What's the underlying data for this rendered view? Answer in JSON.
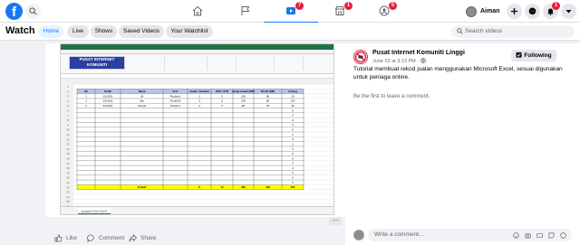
{
  "topbar": {
    "logo": "f",
    "profile_name": "Aiman",
    "nav": [
      {
        "name": "home",
        "badge": ""
      },
      {
        "name": "pages",
        "badge": ""
      },
      {
        "name": "watch",
        "badge": "7"
      },
      {
        "name": "marketplace",
        "badge": "1"
      },
      {
        "name": "groups",
        "badge": "5"
      }
    ],
    "notification_badge": "1"
  },
  "watch": {
    "title": "Watch",
    "tabs": [
      "Home",
      "Live",
      "Shows",
      "Saved Videos",
      "Your Watchlist"
    ],
    "search_placeholder": "Search videos"
  },
  "video": {
    "banner_text": "PUSAT INTERNET KOMUNITI",
    "headers": [
      "Bil",
      "Tarikh",
      "Nama",
      "Item",
      "Jualan / Kuantiti",
      "PKG / STR",
      "Harga Jualan (RM)",
      "Modal (RM)",
      "Untung"
    ],
    "rows": [
      [
        "1",
        "1/1/2021",
        "Ali",
        "Produk A",
        "1",
        "3",
        "100",
        "80",
        "20"
      ],
      [
        "2",
        "2/1/2021",
        "Abu",
        "Produk B",
        "3",
        "5",
        "200",
        "80",
        "120"
      ],
      [
        "3",
        "3/1/2021",
        "Ahmad",
        "Produk A",
        "4",
        "5",
        "80",
        "20",
        "60"
      ]
    ],
    "total_label": "Jumlah",
    "totals": [
      "8",
      "13",
      "380",
      "180",
      "200"
    ],
    "sheet_tab": "Jualan Feb 2021",
    "more_label": "..."
  },
  "actions": {
    "like": "Like",
    "comment": "Comment",
    "share": "Share"
  },
  "post": {
    "page_name": "Pusat Internet Komuniti Linggi",
    "time": "June 22 at 3:13 PM · ",
    "follow_label": "Following",
    "description": "Tutorial membuat rekod jualan menggunakan Microsoft Excel, sesuai digunakan untuk peniaga online.",
    "first_comment": "Be the first to leave a comment.",
    "comment_placeholder": "Write a comment..."
  },
  "colors": {
    "brand": "#1877f2",
    "badge": "#e41e3f",
    "excel": "#217346",
    "total_row": "#ffff00"
  }
}
